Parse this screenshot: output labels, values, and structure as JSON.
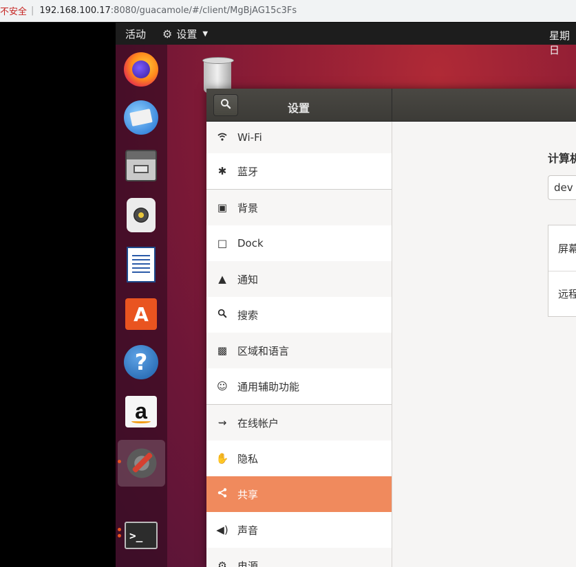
{
  "browser": {
    "security_label": "不安全",
    "url_host": "192.168.100.17",
    "url_path": ":8080/guacamole/#/client/MgBjAG15c3Fs"
  },
  "topbar": {
    "activities": "活动",
    "app_menu": "设置",
    "clock": "星期日"
  },
  "dock": {
    "apps": [
      "firefox-icon",
      "thunderbird-icon",
      "files-icon",
      "rhythmbox-icon",
      "libreoffice-writer-icon",
      "software-center-icon",
      "help-icon",
      "amazon-icon",
      "settings-icon",
      "terminal-icon"
    ],
    "active": "settings-icon"
  },
  "settings": {
    "title": "设置",
    "sidebar": [
      {
        "icon": "wifi-icon",
        "label": "Wi-Fi"
      },
      {
        "icon": "bluetooth-icon",
        "label": "蓝牙"
      },
      {
        "icon": "background-icon",
        "label": "背景"
      },
      {
        "icon": "dock-icon",
        "label": "Dock"
      },
      {
        "icon": "bell-icon",
        "label": "通知"
      },
      {
        "icon": "search-icon",
        "label": "搜索"
      },
      {
        "icon": "region-icon",
        "label": "区域和语言"
      },
      {
        "icon": "accessibility-icon",
        "label": "通用辅助功能"
      },
      {
        "icon": "online-accounts-icon",
        "label": "在线帐户"
      },
      {
        "icon": "privacy-hand-icon",
        "label": "隐私"
      },
      {
        "icon": "share-icon",
        "label": "共享"
      },
      {
        "icon": "speaker-icon",
        "label": "声音"
      },
      {
        "icon": "power-icon",
        "label": "电源"
      }
    ],
    "selected": "共享",
    "content": {
      "heading": "计算机",
      "hostname_value": "dev",
      "items": [
        "屏幕",
        "远程"
      ]
    }
  }
}
